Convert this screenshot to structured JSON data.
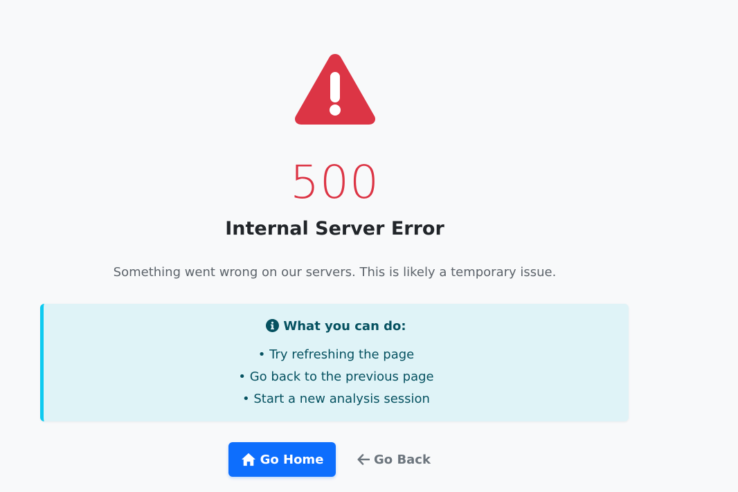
{
  "error": {
    "code": "500",
    "title": "Internal Server Error",
    "description": "Something went wrong on our servers. This is likely a temporary issue."
  },
  "info_box": {
    "heading": "What you can do:",
    "items": [
      "• Try refreshing the page",
      "• Go back to the previous page",
      "• Start a new analysis session"
    ]
  },
  "actions": {
    "home_label": "Go Home",
    "back_label": "Go Back"
  },
  "icons": {
    "warning": "exclamation-triangle-icon",
    "info": "info-circle-icon",
    "home": "home-icon",
    "back": "arrow-left-icon"
  },
  "colors": {
    "danger": "#dc3545",
    "primary": "#0d6efd",
    "info_accent": "#0dcaf0",
    "info_bg": "#dff3f7",
    "info_text": "#055160",
    "muted": "#6c757d"
  }
}
